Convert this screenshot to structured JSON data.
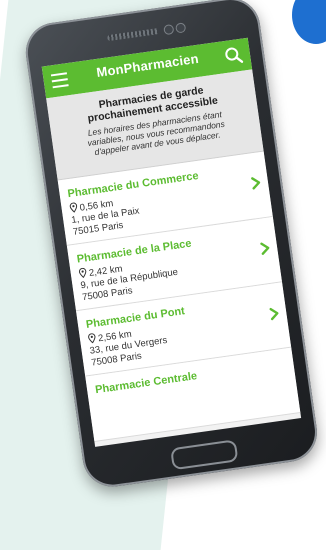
{
  "app": {
    "title": "MonPharmacien"
  },
  "intro": {
    "title_line1": "Pharmacies de garde",
    "title_line2": "prochainement accessible",
    "note_line1": "Les horaires des pharmaciens étant",
    "note_line2": "variables, nous vous recommandons",
    "note_line3": "d'appeler avant de vous déplacer."
  },
  "pharmacies": [
    {
      "name": "Pharmacie du Commerce",
      "distance": "0,56 km",
      "street": "1, rue de la Paix",
      "city": "75015 Paris"
    },
    {
      "name": "Pharmacie de la Place",
      "distance": "2,42 km",
      "street": "9, rue de la République",
      "city": "75008 Paris"
    },
    {
      "name": "Pharmacie du Pont",
      "distance": "2,56 km",
      "street": "33, rue du Vergers",
      "city": "75008 Paris"
    },
    {
      "name": "Pharmacie Centrale"
    }
  ],
  "colors": {
    "brand_green": "#5cbc31",
    "accent_blue": "#1e6fd0"
  },
  "icons": {
    "menu": "hamburger-menu-icon",
    "search": "search-icon",
    "distance": "map-pin-icon",
    "chevron": "chevron-right-icon"
  }
}
